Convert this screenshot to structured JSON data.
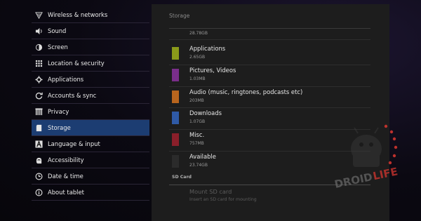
{
  "sidebar": {
    "items": [
      {
        "label": "Wireless & networks",
        "icon": "wifi-icon",
        "active": false
      },
      {
        "label": "Sound",
        "icon": "speaker-icon",
        "active": false
      },
      {
        "label": "Screen",
        "icon": "brightness-icon",
        "active": false
      },
      {
        "label": "Location & security",
        "icon": "grid-lock-icon",
        "active": false
      },
      {
        "label": "Applications",
        "icon": "applications-icon",
        "active": false
      },
      {
        "label": "Accounts & sync",
        "icon": "sync-icon",
        "active": false
      },
      {
        "label": "Privacy",
        "icon": "privacy-icon",
        "active": false
      },
      {
        "label": "Storage",
        "icon": "sd-card-icon",
        "active": true
      },
      {
        "label": "Language & input",
        "icon": "language-icon",
        "active": false
      },
      {
        "label": "Accessibility",
        "icon": "accessibility-icon",
        "active": false
      },
      {
        "label": "Date & time",
        "icon": "clock-icon",
        "active": false
      },
      {
        "label": "About tablet",
        "icon": "info-icon",
        "active": false
      }
    ]
  },
  "storage": {
    "title": "Storage",
    "top_value": "28.78GB",
    "rows": [
      {
        "label": "Applications",
        "value": "2.65GB",
        "color": "#8a9a1a"
      },
      {
        "label": "Pictures, Videos",
        "value": "1.03MB",
        "color": "#7a2e8a"
      },
      {
        "label": "Audio (music, ringtones, podcasts etc)",
        "value": "203MB",
        "color": "#b8651e"
      },
      {
        "label": "Downloads",
        "value": "1.07GB",
        "color": "#2f5aa6"
      },
      {
        "label": "Misc.",
        "value": "757MB",
        "color": "#8a1f2a"
      },
      {
        "label": "Available",
        "value": "23.74GB",
        "color": "#2b2b2b"
      }
    ],
    "sd_header": "SD Card",
    "mount_title": "Mount SD card",
    "mount_summary": "Insert an SD card for mounting"
  },
  "watermark": {
    "text": "DROIDLIFE",
    "accent": "#d0352f"
  }
}
